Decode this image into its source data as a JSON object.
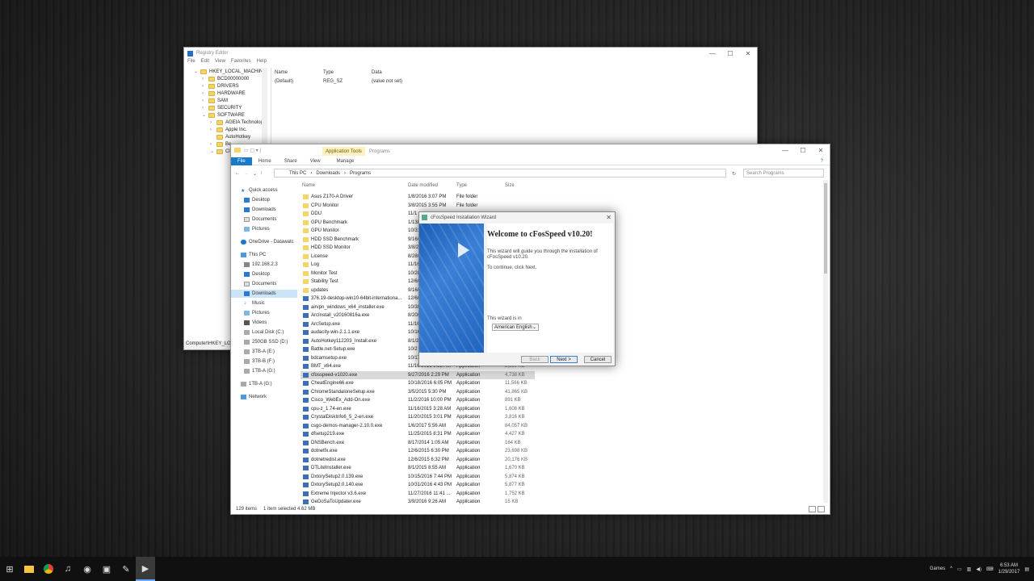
{
  "registry": {
    "title": "Registry Editor",
    "menu": [
      "File",
      "Edit",
      "View",
      "Favorites",
      "Help"
    ],
    "tree": [
      "HKEY_LOCAL_MACHINE",
      "BCD00000000",
      "DRIVERS",
      "HARDWARE",
      "SAM",
      "SECURITY",
      "SOFTWARE",
      "AGEIA Technologi",
      "Apple Inc.",
      "AutoHotkey",
      "Be",
      "Cl"
    ],
    "columns": [
      "Name",
      "Type",
      "Data"
    ],
    "row": {
      "name": "(Default)",
      "type": "REG_SZ",
      "data": "(value not set)"
    },
    "status": "Computer\\HKEY_LOC"
  },
  "explorer": {
    "context_tab": "Application Tools",
    "title": "Programs",
    "manage": "Manage",
    "tabs": [
      "File",
      "Home",
      "Share",
      "View"
    ],
    "breadcrumb": [
      "This PC",
      "Downloads",
      "Programs"
    ],
    "search_placeholder": "Search Programs",
    "nav": [
      "Quick access",
      "Desktop",
      "Downloads",
      "Documents",
      "Pictures",
      "OneDrive - Datawatc",
      "This PC",
      "192.168.2.3",
      "Desktop",
      "Documents",
      "Downloads",
      "Music",
      "Pictures",
      "Videos",
      "Local Disk (C:)",
      "250GB SSD (D:)",
      "3TB-A (E:)",
      "3TB-B (F:)",
      "1TB-A (G:)",
      "1TB-A (G:)",
      "Network"
    ],
    "columns": [
      "Name",
      "Date modified",
      "Type",
      "Size"
    ],
    "files": [
      [
        "Asus Z170-A Driver",
        "1/8/2016 3:07 PM",
        "File folder",
        ""
      ],
      [
        "CPU Monitor",
        "3/8/2015 3:55 PM",
        "File folder",
        ""
      ],
      [
        "DDU",
        "11/1",
        "",
        ""
      ],
      [
        "GPU Benchmark",
        "1/13/",
        "",
        ""
      ],
      [
        "GPU Monitor",
        "10/31/2016 4:36 PM",
        "File folder",
        ""
      ],
      [
        "HDD SSD Benchmark",
        "9/16/2016 12:02 PM",
        "File folder",
        ""
      ],
      [
        "HDD SSD Monitor",
        "3/8/2015 3:55 PM",
        "File folder",
        ""
      ],
      [
        "License",
        "8/28/2016 1:44 PM",
        "File folder",
        ""
      ],
      [
        "Log",
        "11/16/2016 2:51 AM",
        "File folder",
        ""
      ],
      [
        "Monitor Test",
        "10/28/2016 3:21 PM",
        "File folder",
        ""
      ],
      [
        "Stability Test",
        "12/6/2016 12:52 PM",
        "File folder",
        ""
      ],
      [
        "updates",
        "9/16/2016 1:30 AM",
        "File folder",
        ""
      ],
      [
        "376.19-desktop-win10-64bit-internationa...",
        "12/6/2016 6:23 PM",
        "Application",
        "354,509 KB"
      ],
      [
        "airvpn_windows_x64_installer.exe",
        "10/3/2016 3:06 AM",
        "Application",
        "5,603 KB"
      ],
      [
        "ArcInstall_v20160816a.exe",
        "8/20/2016 11:27 AM",
        "Application",
        "9,770 KB"
      ],
      [
        "ArcSetup.exe",
        "11/16/2016 1:37 AM",
        "Application",
        "1,403 KB"
      ],
      [
        "audacity-win-2.1.1.exe",
        "10/16/2015",
        "Application",
        "",
        ""
      ],
      [
        "AutoHotkey112203_Install.exe",
        "8/1/2015",
        "Application",
        "2,802 KB"
      ],
      [
        "Battle.net-Setup.exe",
        "10/2",
        "Application",
        "3,374 KB"
      ],
      [
        "bdcamsetup.exe",
        "10/17/2016 1:15 AM",
        "Application",
        "16,258 KB"
      ],
      [
        "BMT_x64.exe",
        "11/16/2016 9:52 AM",
        "Application",
        "2,159 KB"
      ],
      [
        "cfosspeed-v1020.exe",
        "9/27/2016 2:29 PM",
        "Application",
        "4,738 KB"
      ],
      [
        "CheatEngine66.exe",
        "10/18/2016 6:05 PM",
        "Application",
        "11,566 KB"
      ],
      [
        "ChromeStandaloneSetup.exe",
        "3/5/2015 5:30 PM",
        "Application",
        "41,865 KB"
      ],
      [
        "Cisco_WebEx_Add-On.exe",
        "11/2/2016 10:00 PM",
        "Application",
        "891 KB"
      ],
      [
        "cpu-z_1.74-en.exe",
        "11/16/2015 3:28 AM",
        "Application",
        "1,608 KB"
      ],
      [
        "CrystalDiskInfo6_5_2-en.exe",
        "11/20/2015 3:01 PM",
        "Application",
        "3,816 KB"
      ],
      [
        "csgo-demos-manager-2.10.0.exe",
        "1/6/2017 5:56 AM",
        "Application",
        "84,057 KB"
      ],
      [
        "dfsetup219.exe",
        "11/25/2015 8:31 PM",
        "Application",
        "4,427 KB"
      ],
      [
        "DNSBench.exe",
        "8/17/2014 1:05 AM",
        "Application",
        "164 KB"
      ],
      [
        "dotnetfx.exe",
        "12/6/2015 6:30 PM",
        "Application",
        "23,698 KB"
      ],
      [
        "dotnetredist.exe",
        "12/6/2015 6:32 PM",
        "Application",
        "20,176 KB"
      ],
      [
        "DTLiteInstaller.exe",
        "8/1/2015 8:55 AM",
        "Application",
        "1,670 KB"
      ],
      [
        "DxtorySetup2.0.139.exe",
        "10/15/2016 7:44 PM",
        "Application",
        "5,874 KB"
      ],
      [
        "DxtorySetup2.0.140.exe",
        "10/31/2016 4:43 PM",
        "Application",
        "5,877 KB"
      ],
      [
        "Extreme Injector v3.6.exe",
        "11/27/2016 11:41 ...",
        "Application",
        "1,752 KB"
      ],
      [
        "GeDoSaToUpdater.exe",
        "3/9/2016 9:26 AM",
        "Application",
        "15 KB"
      ]
    ],
    "status": {
      "count": "129 items",
      "selected": "1 item selected  4.62 MB"
    }
  },
  "wizard": {
    "title": "cFosSpeed Installation Wizard",
    "heading": "Welcome to cFosSpeed v10.20!",
    "text1": "This wizard will guide you through the installation of cFosSpeed v10.20.",
    "text2": "To continue, click Next.",
    "lang_label": "This wizard is in",
    "lang": "American English",
    "back": "Back",
    "next": "Next >",
    "cancel": "Cancel"
  },
  "taskbar": {
    "tray_label": "Games",
    "time": "6:53 AM",
    "date": "1/29/2017"
  }
}
